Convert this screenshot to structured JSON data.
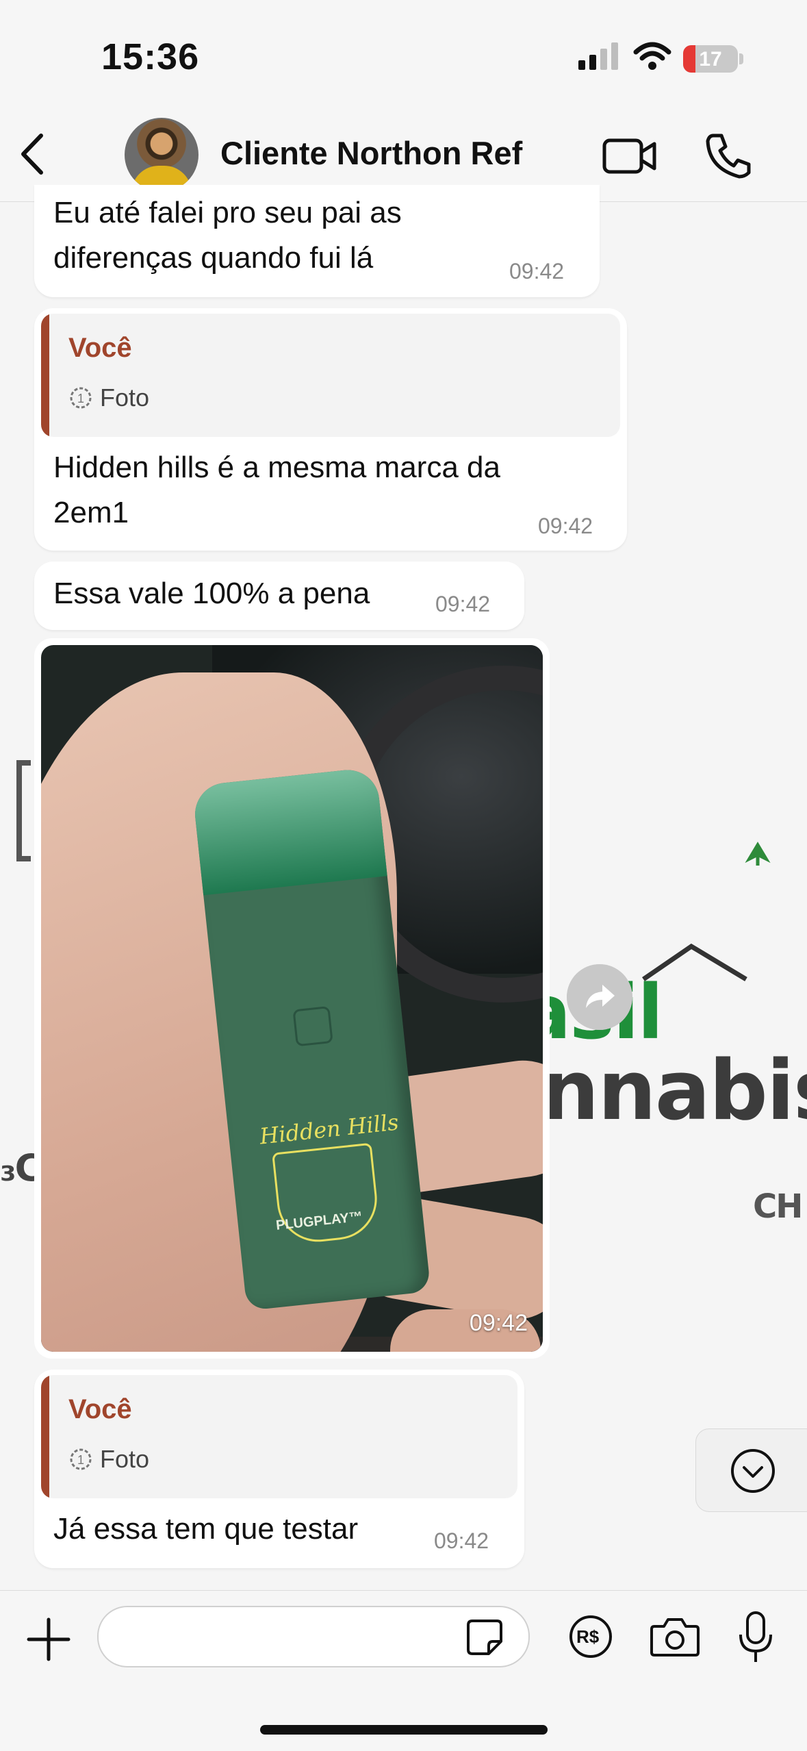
{
  "status_bar": {
    "time": "15:36",
    "battery": "17"
  },
  "header": {
    "contact_name": "Cliente Northon Ref"
  },
  "messages": {
    "m1": {
      "line1": "Eu até falei pro seu pai as",
      "line2": "diferenças quando fui lá",
      "time": "09:42"
    },
    "m2": {
      "quote_author": "Você",
      "quote_kind": "Foto",
      "line1": "Hidden hills é a mesma marca da",
      "line2": "2em1",
      "time": "09:42"
    },
    "m3": {
      "text": "Essa vale 100% a pena",
      "time": "09:42"
    },
    "m4": {
      "type": "photo",
      "time": "09:42",
      "photo_brand_1": "Hidden Hills",
      "photo_brand_2": "PLUGPLAY™"
    },
    "m5": {
      "quote_author": "Você",
      "quote_kind": "Foto",
      "text": "Já essa tem que testar",
      "time": "09:42"
    }
  },
  "wallpaper": {
    "w1": "asil",
    "w2": "nnabis",
    "w3": "CH",
    "w4": "₃C"
  },
  "input": {
    "placeholder": ""
  },
  "colors": {
    "quote_accent": "#a0452c",
    "bubble": "#ffffff",
    "background": "#f3f3f3"
  }
}
